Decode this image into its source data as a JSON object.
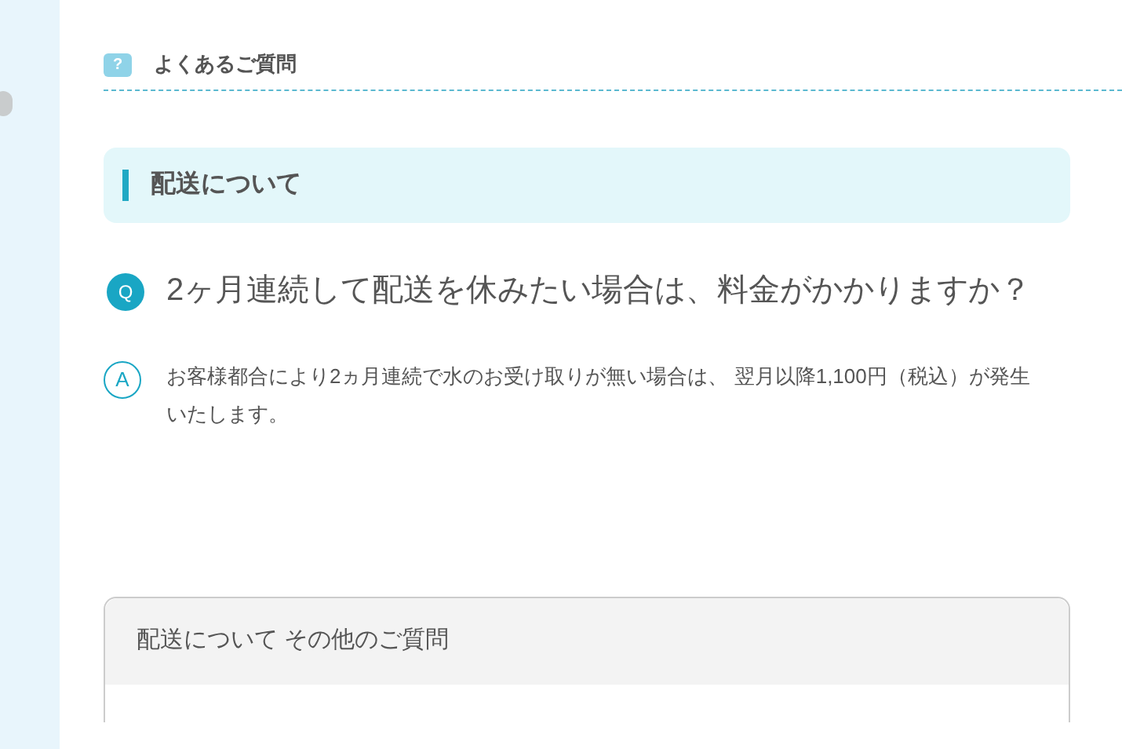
{
  "header": {
    "title": "よくあるご質問",
    "icon_text": "?"
  },
  "category": {
    "title": "配送について"
  },
  "faq": {
    "question_mark": "Q",
    "question": "2ヶ月連続して配送を休みたい場合は、料金がかかりますか？",
    "answer_mark": "A",
    "answer": "お客様都合により2ヵ月連続で水のお受け取りが無い場合は、 翌月以降1,100円（税込）が発生いたします。"
  },
  "more_panel": {
    "title": "配送について その他のご質問"
  }
}
